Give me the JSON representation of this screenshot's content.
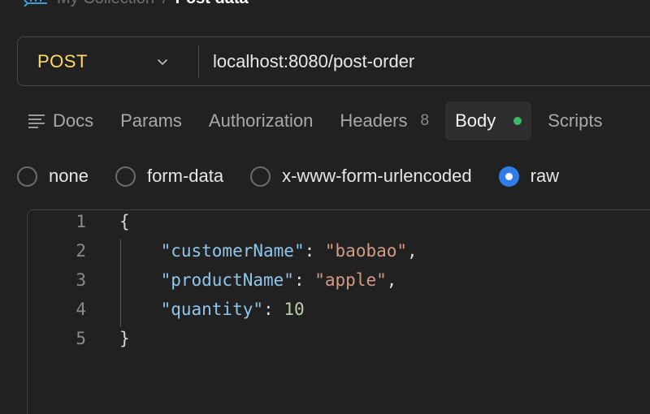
{
  "breadcrumb": {
    "parent": "My Collection",
    "separator": "/",
    "current": "Post data"
  },
  "request": {
    "method": "POST",
    "url": "localhost:8080/post-order"
  },
  "tabs": [
    {
      "label": "Docs"
    },
    {
      "label": "Params"
    },
    {
      "label": "Authorization"
    },
    {
      "label": "Headers",
      "count": "8"
    },
    {
      "label": "Body",
      "active": true
    },
    {
      "label": "Scripts"
    }
  ],
  "body_types": [
    {
      "label": "none",
      "selected": false
    },
    {
      "label": "form-data",
      "selected": false
    },
    {
      "label": "x-www-form-urlencoded",
      "selected": false
    },
    {
      "label": "raw",
      "selected": true
    }
  ],
  "editor": {
    "line_numbers": [
      "1",
      "2",
      "3",
      "4",
      "5"
    ],
    "open_brace": "{",
    "close_brace": "}",
    "fields": [
      {
        "key": "\"customerName\"",
        "value": "\"baobao\"",
        "type": "string",
        "trailing": ","
      },
      {
        "key": "\"productName\"",
        "value": "\"apple\"",
        "type": "string",
        "trailing": ","
      },
      {
        "key": "\"quantity\"",
        "value": "10",
        "type": "number",
        "trailing": ""
      }
    ]
  },
  "colors": {
    "method": "#ffd966",
    "body_dot": "#3cb964",
    "radio_selected": "#2f7de8",
    "json_key": "#8fc6ec",
    "json_string": "#d49a84",
    "json_number": "#b8cca8"
  }
}
